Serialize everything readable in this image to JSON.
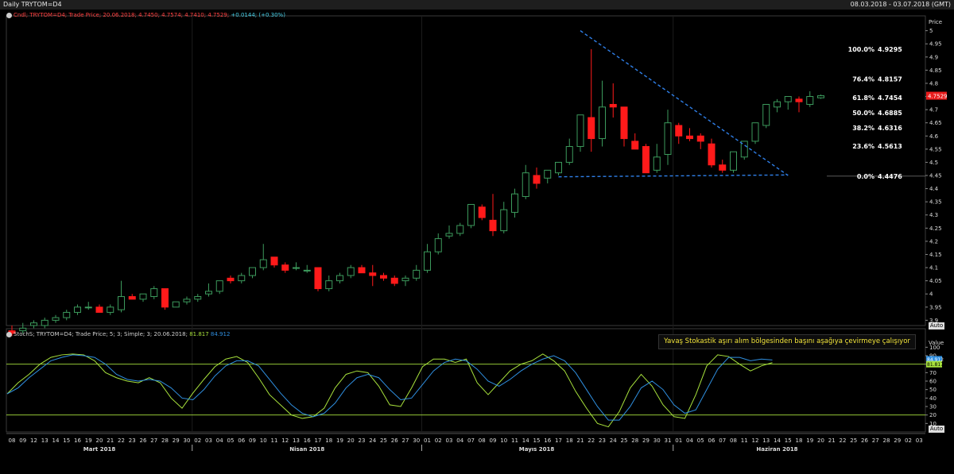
{
  "window": {
    "title": "Daily TRYTOM=D4",
    "date_range": "08.03.2018 - 03.07.2018 (GMT)"
  },
  "price_legend": {
    "name": "Cndl; TRYTOM=D4; Trade Price; 20.06.2018; 4.7450; 4.7574; 4.7410; 4.7529;",
    "change": "+0.0144; (+0.30%)"
  },
  "stoch_legend": {
    "name": "StochS; TRYTOM=D4; Trade Price;  5; 3; Simple; 3; 20.06.2018;",
    "k_value": "81.817",
    "d_value": "84.912"
  },
  "annotation": "Yavaş Stokastik aşırı alım bölgesinden başını aşağıya çevirmeye çalışıyor",
  "axis_buttons": {
    "price": "Auto",
    "stoch": "Auto"
  },
  "colors": {
    "up": "#2a8a4a",
    "down": "#ff1a1a",
    "trend": "#2f7fe8",
    "stoch_k": "#a8e23c",
    "stoch_d": "#2f8fe0",
    "levels": "#a8e23c"
  },
  "chart_data": [
    {
      "type": "candlestick",
      "title": "Daily TRYTOM=D4",
      "ylabel": "Price",
      "ylim": [
        3.88,
        5.02
      ],
      "yticks": [
        3.9,
        3.95,
        4,
        4.05,
        4.1,
        4.15,
        4.2,
        4.25,
        4.3,
        4.35,
        4.4,
        4.45,
        4.5,
        4.55,
        4.6,
        4.65,
        4.7,
        4.75,
        4.8,
        4.85,
        4.9,
        4.95,
        5
      ],
      "yticks_labels": [
        "3.9",
        "3.95",
        "4",
        "4.05",
        "4.1",
        "4.15",
        "4.2",
        "4.25",
        "4.3",
        "4.35",
        "4.4",
        "4.45",
        "4.5",
        "4.55",
        "4.6",
        "4.65",
        "4.7",
        "4.75",
        "4.8",
        "4.85",
        "4.9",
        "4.95",
        "5"
      ],
      "x_day_labels": [
        "08",
        "09",
        "12",
        "13",
        "14",
        "15",
        "16",
        "19",
        "20",
        "21",
        "22",
        "23",
        "26",
        "27",
        "28",
        "29",
        "30",
        "02",
        "03",
        "04",
        "05",
        "06",
        "09",
        "10",
        "11",
        "12",
        "13",
        "16",
        "17",
        "18",
        "19",
        "20",
        "23",
        "24",
        "25",
        "26",
        "27",
        "30",
        "01",
        "02",
        "03",
        "04",
        "07",
        "08",
        "09",
        "10",
        "11",
        "14",
        "15",
        "16",
        "17",
        "18",
        "21",
        "22",
        "23",
        "24",
        "25",
        "28",
        "29",
        "30",
        "31",
        "01",
        "04",
        "05",
        "06",
        "07",
        "08",
        "11",
        "12",
        "13",
        "14",
        "15",
        "18",
        "19",
        "20",
        "21",
        "22",
        "25",
        "26",
        "27",
        "28",
        "29",
        "02",
        "03"
      ],
      "month_labels": [
        {
          "label": "Mart 2018",
          "index": 8
        },
        {
          "label": "Nisan 2018",
          "index": 27
        },
        {
          "label": "Mayıs 2018",
          "index": 48
        },
        {
          "label": "Haziran 2018",
          "index": 70
        }
      ],
      "month_separators": [
        17,
        38,
        61
      ],
      "ohlc": [
        [
          3.86,
          3.88,
          3.84,
          3.85
        ],
        [
          3.86,
          3.89,
          3.85,
          3.87
        ],
        [
          3.88,
          3.9,
          3.87,
          3.89
        ],
        [
          3.88,
          3.91,
          3.87,
          3.9
        ],
        [
          3.9,
          3.92,
          3.89,
          3.91
        ],
        [
          3.91,
          3.94,
          3.9,
          3.93
        ],
        [
          3.93,
          3.96,
          3.92,
          3.95
        ],
        [
          3.95,
          3.97,
          3.94,
          3.95
        ],
        [
          3.95,
          3.96,
          3.93,
          3.93
        ],
        [
          3.93,
          3.96,
          3.92,
          3.95
        ],
        [
          3.94,
          4.05,
          3.93,
          3.99
        ],
        [
          3.99,
          4.0,
          3.98,
          3.98
        ],
        [
          3.98,
          4.0,
          3.97,
          4.0
        ],
        [
          3.99,
          4.03,
          3.98,
          4.02
        ],
        [
          4.02,
          4.02,
          3.94,
          3.95
        ],
        [
          3.95,
          3.97,
          3.95,
          3.97
        ],
        [
          3.97,
          3.99,
          3.96,
          3.98
        ],
        [
          3.98,
          4.0,
          3.97,
          3.99
        ],
        [
          4.0,
          4.04,
          3.99,
          4.01
        ],
        [
          4.01,
          4.05,
          4.0,
          4.05
        ],
        [
          4.06,
          4.07,
          4.04,
          4.05
        ],
        [
          4.05,
          4.08,
          4.04,
          4.07
        ],
        [
          4.07,
          4.1,
          4.06,
          4.1
        ],
        [
          4.1,
          4.19,
          4.09,
          4.13
        ],
        [
          4.14,
          4.14,
          4.1,
          4.11
        ],
        [
          4.11,
          4.12,
          4.08,
          4.09
        ],
        [
          4.1,
          4.12,
          4.09,
          4.1
        ],
        [
          4.09,
          4.11,
          4.08,
          4.09
        ],
        [
          4.1,
          4.1,
          4.01,
          4.02
        ],
        [
          4.02,
          4.07,
          4.01,
          4.05
        ],
        [
          4.05,
          4.08,
          4.04,
          4.07
        ],
        [
          4.07,
          4.11,
          4.06,
          4.1
        ],
        [
          4.1,
          4.11,
          4.08,
          4.08
        ],
        [
          4.08,
          4.11,
          4.03,
          4.07
        ],
        [
          4.07,
          4.08,
          4.05,
          4.06
        ],
        [
          4.06,
          4.07,
          4.03,
          4.04
        ],
        [
          4.05,
          4.07,
          4.03,
          4.06
        ],
        [
          4.06,
          4.11,
          4.05,
          4.09
        ],
        [
          4.09,
          4.19,
          4.08,
          4.16
        ],
        [
          4.16,
          4.23,
          4.15,
          4.21
        ],
        [
          4.22,
          4.26,
          4.21,
          4.23
        ],
        [
          4.23,
          4.27,
          4.22,
          4.26
        ],
        [
          4.26,
          4.33,
          4.25,
          4.34
        ],
        [
          4.33,
          4.34,
          4.28,
          4.29
        ],
        [
          4.28,
          4.38,
          4.22,
          4.24
        ],
        [
          4.24,
          4.35,
          4.23,
          4.32
        ],
        [
          4.31,
          4.4,
          4.29,
          4.38
        ],
        [
          4.37,
          4.49,
          4.36,
          4.46
        ],
        [
          4.45,
          4.48,
          4.4,
          4.42
        ],
        [
          4.44,
          4.46,
          4.42,
          4.47
        ],
        [
          4.46,
          4.49,
          4.45,
          4.5
        ],
        [
          4.5,
          4.59,
          4.49,
          4.56
        ],
        [
          4.56,
          4.68,
          4.54,
          4.68
        ],
        [
          4.67,
          4.93,
          4.54,
          4.59
        ],
        [
          4.59,
          4.81,
          4.56,
          4.71
        ],
        [
          4.72,
          4.8,
          4.67,
          4.71
        ],
        [
          4.71,
          4.71,
          4.56,
          4.59
        ],
        [
          4.58,
          4.61,
          4.55,
          4.55
        ],
        [
          4.56,
          4.57,
          4.46,
          4.46
        ],
        [
          4.47,
          4.57,
          4.46,
          4.52
        ],
        [
          4.53,
          4.7,
          4.49,
          4.65
        ],
        [
          4.64,
          4.65,
          4.57,
          4.6
        ],
        [
          4.6,
          4.63,
          4.58,
          4.59
        ],
        [
          4.6,
          4.61,
          4.55,
          4.58
        ],
        [
          4.57,
          4.59,
          4.48,
          4.49
        ],
        [
          4.49,
          4.51,
          4.46,
          4.47
        ],
        [
          4.47,
          4.52,
          4.46,
          4.54
        ],
        [
          4.52,
          4.58,
          4.51,
          4.58
        ],
        [
          4.58,
          4.64,
          4.57,
          4.65
        ],
        [
          4.64,
          4.72,
          4.63,
          4.72
        ],
        [
          4.71,
          4.74,
          4.69,
          4.73
        ],
        [
          4.73,
          4.75,
          4.7,
          4.75
        ],
        [
          4.74,
          4.75,
          4.69,
          4.73
        ],
        [
          4.72,
          4.77,
          4.71,
          4.75
        ],
        [
          4.745,
          4.7574,
          4.741,
          4.7529
        ]
      ],
      "fibonacci": [
        {
          "label": "100.0%",
          "value": "4.9295"
        },
        {
          "label": "76.4%",
          "value": "4.8157"
        },
        {
          "label": "61.8%",
          "value": "4.7454"
        },
        {
          "label": "50.0%",
          "value": "4.6885"
        },
        {
          "label": "38.2%",
          "value": "4.6316"
        },
        {
          "label": "23.6%",
          "value": "4.5613"
        },
        {
          "label": "0.0%",
          "value": "4.4476"
        }
      ],
      "trendlines": [
        {
          "name": "descending",
          "from": {
            "index": 52,
            "price": 5.0
          },
          "to": {
            "index": 71,
            "price": 4.45
          }
        },
        {
          "name": "support",
          "from": {
            "index": 50,
            "price": 4.445
          },
          "to": {
            "index": 71,
            "price": 4.452
          }
        }
      ],
      "last_price": "4.7529"
    },
    {
      "type": "line",
      "title": "StochS",
      "ylabel": "Value",
      "ylim": [
        0,
        105
      ],
      "yticks": [
        10,
        20,
        30,
        40,
        50,
        60,
        70,
        80,
        90,
        100
      ],
      "levels": [
        20,
        80
      ],
      "series": [
        {
          "name": "%K",
          "values": [
            45,
            58,
            68,
            80,
            88,
            91,
            92,
            91,
            84,
            70,
            64,
            60,
            58,
            64,
            58,
            40,
            28,
            46,
            62,
            77,
            86,
            89,
            82,
            64,
            44,
            32,
            20,
            16,
            18,
            28,
            52,
            68,
            72,
            70,
            54,
            32,
            30,
            52,
            77,
            86,
            86,
            82,
            86,
            58,
            44,
            58,
            72,
            80,
            84,
            92,
            84,
            72,
            48,
            28,
            10,
            6,
            24,
            52,
            68,
            54,
            32,
            18,
            16,
            44,
            78,
            91,
            89,
            80,
            72,
            78,
            81.817
          ]
        },
        {
          "name": "%D",
          "values": [
            45,
            52,
            64,
            74,
            84,
            88,
            91,
            90,
            88,
            80,
            68,
            62,
            60,
            62,
            60,
            52,
            40,
            38,
            50,
            66,
            78,
            84,
            84,
            78,
            62,
            46,
            32,
            22,
            18,
            22,
            34,
            52,
            64,
            68,
            64,
            50,
            38,
            40,
            56,
            72,
            82,
            86,
            84,
            74,
            60,
            54,
            62,
            72,
            80,
            86,
            90,
            84,
            70,
            50,
            30,
            14,
            14,
            30,
            52,
            60,
            50,
            32,
            22,
            26,
            50,
            74,
            88,
            88,
            84,
            86,
            84.912
          ]
        }
      ]
    }
  ]
}
